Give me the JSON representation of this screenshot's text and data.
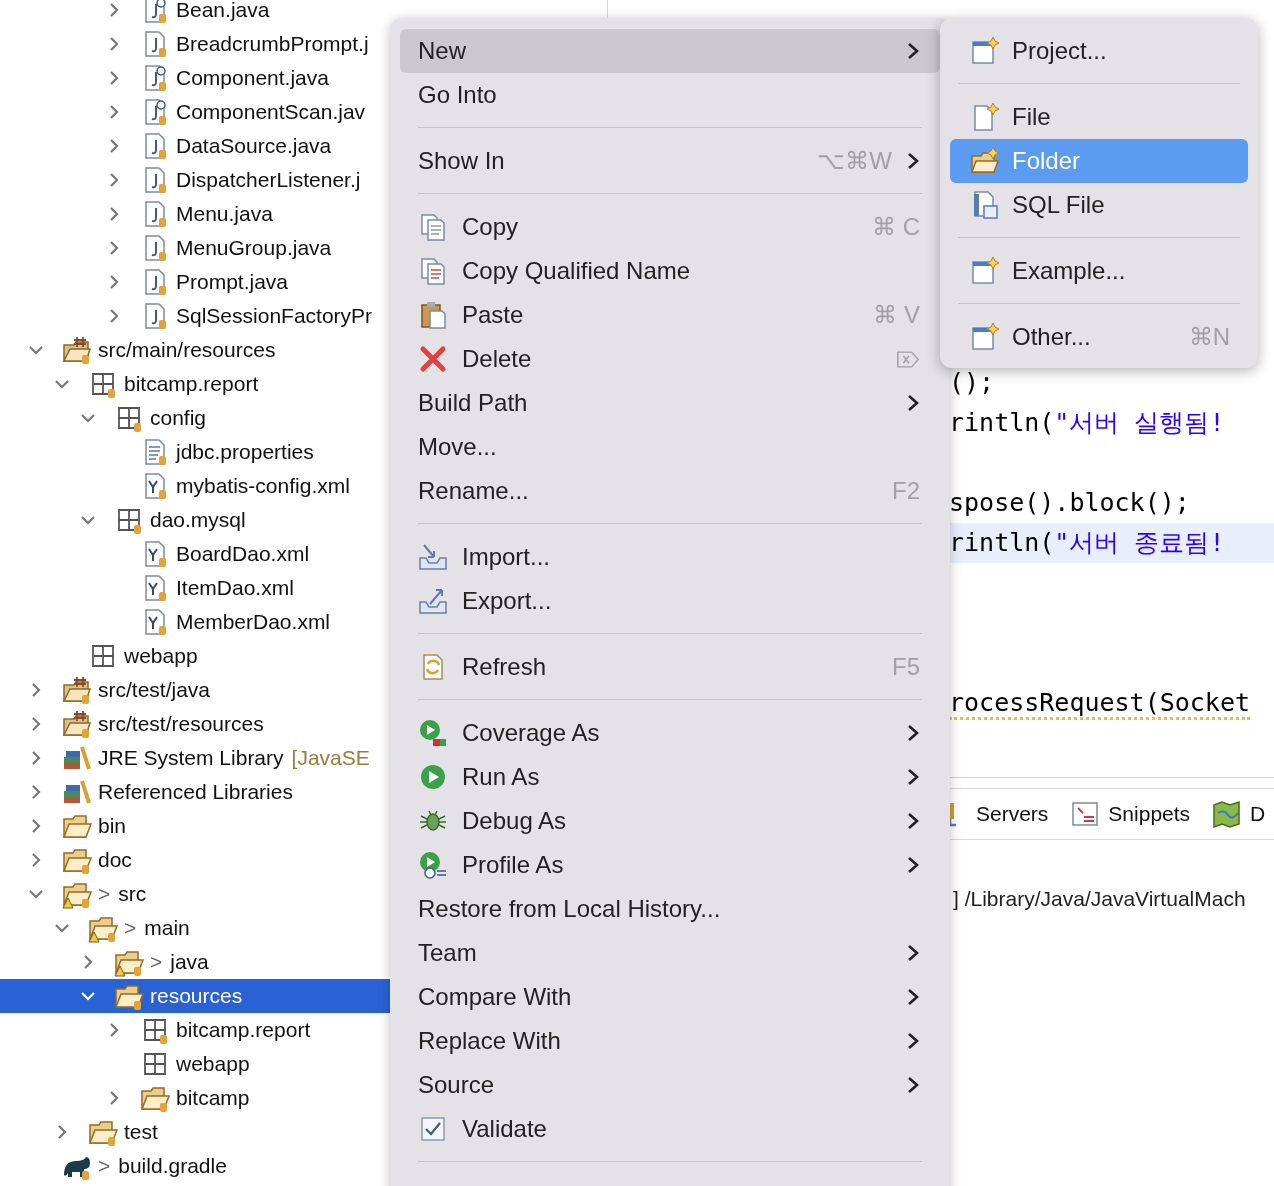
{
  "tree": [
    {
      "children": [
        {
          "children": [
            {
              "children": [
                {
                  "label": "Bean.java",
                  "kind": "annotation-file",
                  "expanded": false,
                  "selected": false
                },
                {
                  "label": "BreadcrumbPrompt.j",
                  "kind": "java-file",
                  "expanded": false,
                  "selected": false
                },
                {
                  "label": "Component.java",
                  "kind": "annotation-file",
                  "expanded": false,
                  "selected": false
                },
                {
                  "label": "ComponentScan.jav",
                  "kind": "annotation-file",
                  "expanded": false,
                  "selected": false
                },
                {
                  "label": "DataSource.java",
                  "kind": "java-file",
                  "expanded": false,
                  "selected": false
                },
                {
                  "label": "DispatcherListener.j",
                  "kind": "java-file",
                  "expanded": false,
                  "selected": false
                },
                {
                  "label": "Menu.java",
                  "kind": "java-file",
                  "expanded": false,
                  "selected": false
                },
                {
                  "label": "MenuGroup.java",
                  "kind": "java-file",
                  "expanded": false,
                  "selected": false
                },
                {
                  "label": "Prompt.java",
                  "kind": "java-file",
                  "expanded": false,
                  "selected": false
                },
                {
                  "label": "SqlSessionFactoryPr",
                  "kind": "java-file",
                  "expanded": false,
                  "selected": false
                }
              ]
            }
          ]
        }
      ]
    },
    {
      "label": "src/main/resources",
      "kind": "source-folder",
      "expanded": true,
      "selected": false,
      "children": [
        {
          "label": "bitcamp.report",
          "kind": "package",
          "expanded": true,
          "selected": false,
          "children": [
            {
              "label": "config",
              "kind": "package",
              "expanded": true,
              "selected": false,
              "children": [
                {
                  "label": "jdbc.properties",
                  "kind": "properties-file",
                  "selected": false
                },
                {
                  "label": "mybatis-config.xml",
                  "kind": "xml-file",
                  "selected": false
                }
              ]
            },
            {
              "label": "dao.mysql",
              "kind": "package",
              "expanded": true,
              "selected": false,
              "children": [
                {
                  "label": "BoardDao.xml",
                  "kind": "xml-file",
                  "selected": false
                },
                {
                  "label": "ItemDao.xml",
                  "kind": "xml-file",
                  "selected": false
                },
                {
                  "label": "MemberDao.xml",
                  "kind": "xml-file",
                  "selected": false
                }
              ]
            }
          ]
        },
        {
          "label": "webapp",
          "kind": "package-plain",
          "selected": false
        }
      ]
    },
    {
      "label": "src/test/java",
      "kind": "source-folder",
      "expanded": false,
      "selected": false
    },
    {
      "label": "src/test/resources",
      "kind": "source-folder",
      "expanded": false,
      "selected": false
    },
    {
      "label": "JRE System Library",
      "decoration": "[JavaSE",
      "kind": "library",
      "expanded": false,
      "selected": false
    },
    {
      "label": "Referenced Libraries",
      "kind": "library",
      "expanded": false,
      "selected": false
    },
    {
      "label": "bin",
      "kind": "folder-plain",
      "expanded": false,
      "selected": false
    },
    {
      "label": "doc",
      "kind": "folder",
      "expanded": false,
      "selected": false
    },
    {
      "label": "src",
      "prefix": ">",
      "kind": "folder-warning",
      "expanded": true,
      "selected": false,
      "children": [
        {
          "label": "main",
          "prefix": ">",
          "kind": "folder-warning",
          "expanded": true,
          "selected": false,
          "children": [
            {
              "label": "java",
              "prefix": ">",
              "kind": "folder-warning",
              "expanded": false,
              "selected": false
            },
            {
              "label": "resources",
              "kind": "folder",
              "expanded": true,
              "selected": true,
              "children": [
                {
                  "label": "bitcamp.report",
                  "kind": "package",
                  "expanded": false,
                  "selected": false
                },
                {
                  "label": "webapp",
                  "kind": "package-plain",
                  "selected": false
                },
                {
                  "label": "bitcamp",
                  "kind": "folder",
                  "expanded": false,
                  "selected": false
                }
              ]
            }
          ]
        },
        {
          "label": "test",
          "kind": "folder",
          "expanded": false,
          "selected": false
        }
      ]
    },
    {
      "label": "build.gradle",
      "prefix": ">",
      "kind": "gradle",
      "selected": false
    }
  ],
  "editor": {
    "lines": [
      {
        "kind": "code",
        "code": "();",
        "highlighted": false,
        "warning": false
      },
      {
        "kind": "code",
        "code": "rintln(",
        "string": "\"서버 실행됨!",
        "highlighted": false,
        "warning": false
      },
      {
        "kind": "blank"
      },
      {
        "kind": "code",
        "code": "spose().block();",
        "highlighted": false,
        "warning": false
      },
      {
        "kind": "code",
        "code": "rintln(",
        "string": "\"서버 종료됨!",
        "highlighted": true,
        "warning": false
      },
      {
        "kind": "blank"
      },
      {
        "kind": "blank"
      },
      {
        "kind": "blank"
      },
      {
        "kind": "code",
        "code": "rocessRequest(Socket",
        "highlighted": false,
        "warning": true
      }
    ]
  },
  "views": {
    "tabs": [
      {
        "label": "Servers",
        "kind": "server"
      },
      {
        "label": "Snippets",
        "kind": "snippets"
      },
      {
        "label": "D",
        "kind": "map"
      }
    ],
    "console_line": "] /Library/Java/JavaVirtualMach"
  },
  "context_menu": {
    "items": [
      {
        "kind": "plain",
        "label": "New",
        "selected": true,
        "has_submenu": true
      },
      {
        "kind": "plain",
        "label": "Go Into",
        "selected": false,
        "has_submenu": false
      },
      {
        "kind": "separator"
      },
      {
        "kind": "plain",
        "label": "Show In",
        "shortcut": "⌥⌘W",
        "selected": false,
        "has_submenu": true
      },
      {
        "kind": "separator"
      },
      {
        "kind": "copy",
        "label": "Copy",
        "shortcut": "⌘ C",
        "selected": false,
        "has_submenu": false
      },
      {
        "kind": "copy-qualified",
        "label": "Copy Qualified Name",
        "selected": false,
        "has_submenu": false
      },
      {
        "kind": "paste",
        "label": "Paste",
        "shortcut": "⌘ V",
        "selected": false,
        "has_submenu": false
      },
      {
        "kind": "delete",
        "label": "Delete",
        "selected": false,
        "has_submenu": false
      },
      {
        "kind": "plain",
        "label": "Build Path",
        "selected": false,
        "has_submenu": true
      },
      {
        "kind": "plain",
        "label": "Move...",
        "selected": false,
        "has_submenu": false
      },
      {
        "kind": "plain",
        "label": "Rename...",
        "shortcut": "F2",
        "selected": false,
        "has_submenu": false
      },
      {
        "kind": "separator"
      },
      {
        "kind": "import",
        "label": "Import...",
        "selected": false,
        "has_submenu": false
      },
      {
        "kind": "export",
        "label": "Export...",
        "selected": false,
        "has_submenu": false
      },
      {
        "kind": "separator"
      },
      {
        "kind": "refresh",
        "label": "Refresh",
        "shortcut": "F5",
        "selected": false,
        "has_submenu": false
      },
      {
        "kind": "separator"
      },
      {
        "kind": "coverage",
        "label": "Coverage As",
        "selected": false,
        "has_submenu": true
      },
      {
        "kind": "run",
        "label": "Run As",
        "selected": false,
        "has_submenu": true
      },
      {
        "kind": "debug",
        "label": "Debug As",
        "selected": false,
        "has_submenu": true
      },
      {
        "kind": "profile",
        "label": "Profile As",
        "selected": false,
        "has_submenu": true
      },
      {
        "kind": "plain",
        "label": "Restore from Local History...",
        "selected": false,
        "has_submenu": false
      },
      {
        "kind": "plain",
        "label": "Team",
        "selected": false,
        "has_submenu": true
      },
      {
        "kind": "plain",
        "label": "Compare With",
        "selected": false,
        "has_submenu": true
      },
      {
        "kind": "plain",
        "label": "Replace With",
        "selected": false,
        "has_submenu": true
      },
      {
        "kind": "plain",
        "label": "Source",
        "selected": false,
        "has_submenu": true
      },
      {
        "kind": "checkbox",
        "label": "Validate",
        "checked": true,
        "selected": false,
        "has_submenu": false
      },
      {
        "kind": "separator"
      }
    ]
  },
  "submenu": {
    "items": [
      {
        "kind": "new-project",
        "label": "Project...",
        "selected": false
      },
      {
        "kind": "separator"
      },
      {
        "kind": "new-file",
        "label": "File",
        "selected": false
      },
      {
        "kind": "new-folder",
        "label": "Folder",
        "selected": true
      },
      {
        "kind": "sql-file",
        "label": "SQL File",
        "selected": false
      },
      {
        "kind": "separator"
      },
      {
        "kind": "new-project",
        "label": "Example...",
        "selected": false
      },
      {
        "kind": "separator"
      },
      {
        "kind": "new-project",
        "label": "Other...",
        "shortcut": "⌘N",
        "selected": false
      }
    ]
  }
}
